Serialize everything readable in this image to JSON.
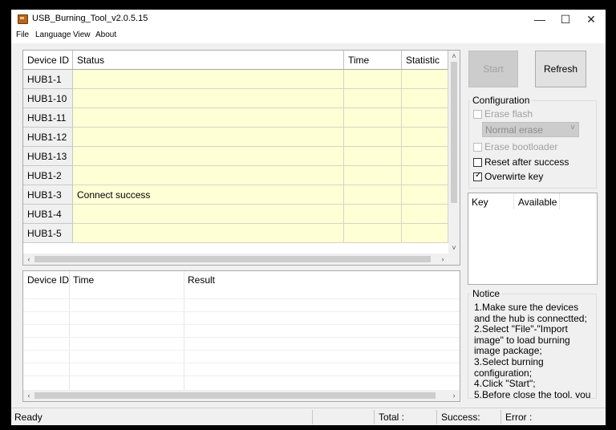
{
  "window": {
    "title": "USB_Burning_Tool_v2.0.5.15",
    "controls": {
      "minimize": "—",
      "maximize": "☐",
      "close": "✕"
    }
  },
  "menu": {
    "items": [
      "File",
      "Language",
      "View",
      "About"
    ]
  },
  "device_table": {
    "headers": [
      "Device ID",
      "Status",
      "Time",
      "Statistic"
    ],
    "rows": [
      {
        "id": "HUB1-1",
        "status": "",
        "time": "",
        "statistic": ""
      },
      {
        "id": "HUB1-10",
        "status": "",
        "time": "",
        "statistic": ""
      },
      {
        "id": "HUB1-11",
        "status": "",
        "time": "",
        "statistic": ""
      },
      {
        "id": "HUB1-12",
        "status": "",
        "time": "",
        "statistic": ""
      },
      {
        "id": "HUB1-13",
        "status": "",
        "time": "",
        "statistic": ""
      },
      {
        "id": "HUB1-2",
        "status": "",
        "time": "",
        "statistic": ""
      },
      {
        "id": "HUB1-3",
        "status": "Connect success",
        "time": "",
        "statistic": ""
      },
      {
        "id": "HUB1-4",
        "status": "",
        "time": "",
        "statistic": ""
      },
      {
        "id": "HUB1-5",
        "status": "",
        "time": "",
        "statistic": ""
      }
    ]
  },
  "result_table": {
    "headers": [
      "Device ID",
      "Time",
      "Result"
    ]
  },
  "buttons": {
    "start": "Start",
    "refresh": "Refresh"
  },
  "configuration": {
    "title": "Configuration",
    "erase_flash": {
      "label": "Erase flash",
      "checked": false,
      "enabled": false
    },
    "erase_mode": {
      "value": "Normal erase",
      "enabled": false
    },
    "erase_bootloader": {
      "label": "Erase bootloader",
      "checked": false,
      "enabled": false
    },
    "reset_after_success": {
      "label": "Reset after success",
      "checked": false,
      "enabled": true
    },
    "overwrite_key": {
      "label": "Overwirte key",
      "checked": true,
      "enabled": true
    }
  },
  "key_table": {
    "headers": [
      "Key",
      "Available"
    ]
  },
  "notice": {
    "title": "Notice",
    "lines": [
      "1.Make sure the devices",
      "and the hub is connectted;",
      "2.Select \"File\"-\"Import",
      "image\" to load burning",
      "image package;",
      "3.Select burning",
      "configuration;",
      "4.Click \"Start\";",
      "5.Before close the tool, you"
    ]
  },
  "statusbar": {
    "ready": "Ready",
    "total": "Total :",
    "success": "Success:",
    "error": "Error :"
  },
  "icons": {
    "scroll_up": "˄",
    "scroll_down": "˅",
    "scroll_left": "‹",
    "scroll_right": "›",
    "select_arrow": "˅",
    "check": "✓"
  },
  "colors": {
    "row_fill": "#ffffd6",
    "disabled_text": "#a0a0a0"
  }
}
